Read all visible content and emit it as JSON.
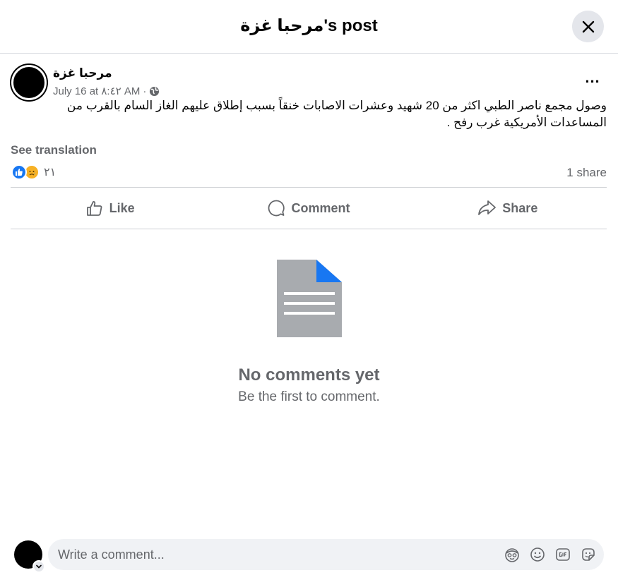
{
  "header": {
    "title": "مرحبا غزة's post"
  },
  "post": {
    "author": "مرحبا غزة",
    "timestamp": "July 16 at ٨:٤٢ AM",
    "separator": "·",
    "text": "وصول مجمع ناصر الطبي اكثر من 20 شهيد وعشرات الاصابات خنقاً بسبب إطلاق عليهم الغاز السام بالقرب من المساعدات الأمريكية غرب رفح .",
    "see_translation": "See translation",
    "reaction_count": "٢١",
    "shares": "1 share"
  },
  "actions": {
    "like": "Like",
    "comment": "Comment",
    "share": "Share"
  },
  "empty_state": {
    "title": "No comments yet",
    "subtitle": "Be the first to comment."
  },
  "composer": {
    "placeholder": "Write a comment..."
  },
  "colors": {
    "accent": "#1877f2",
    "secondary_text": "#65676b",
    "doc_gray": "#a8abaf"
  }
}
